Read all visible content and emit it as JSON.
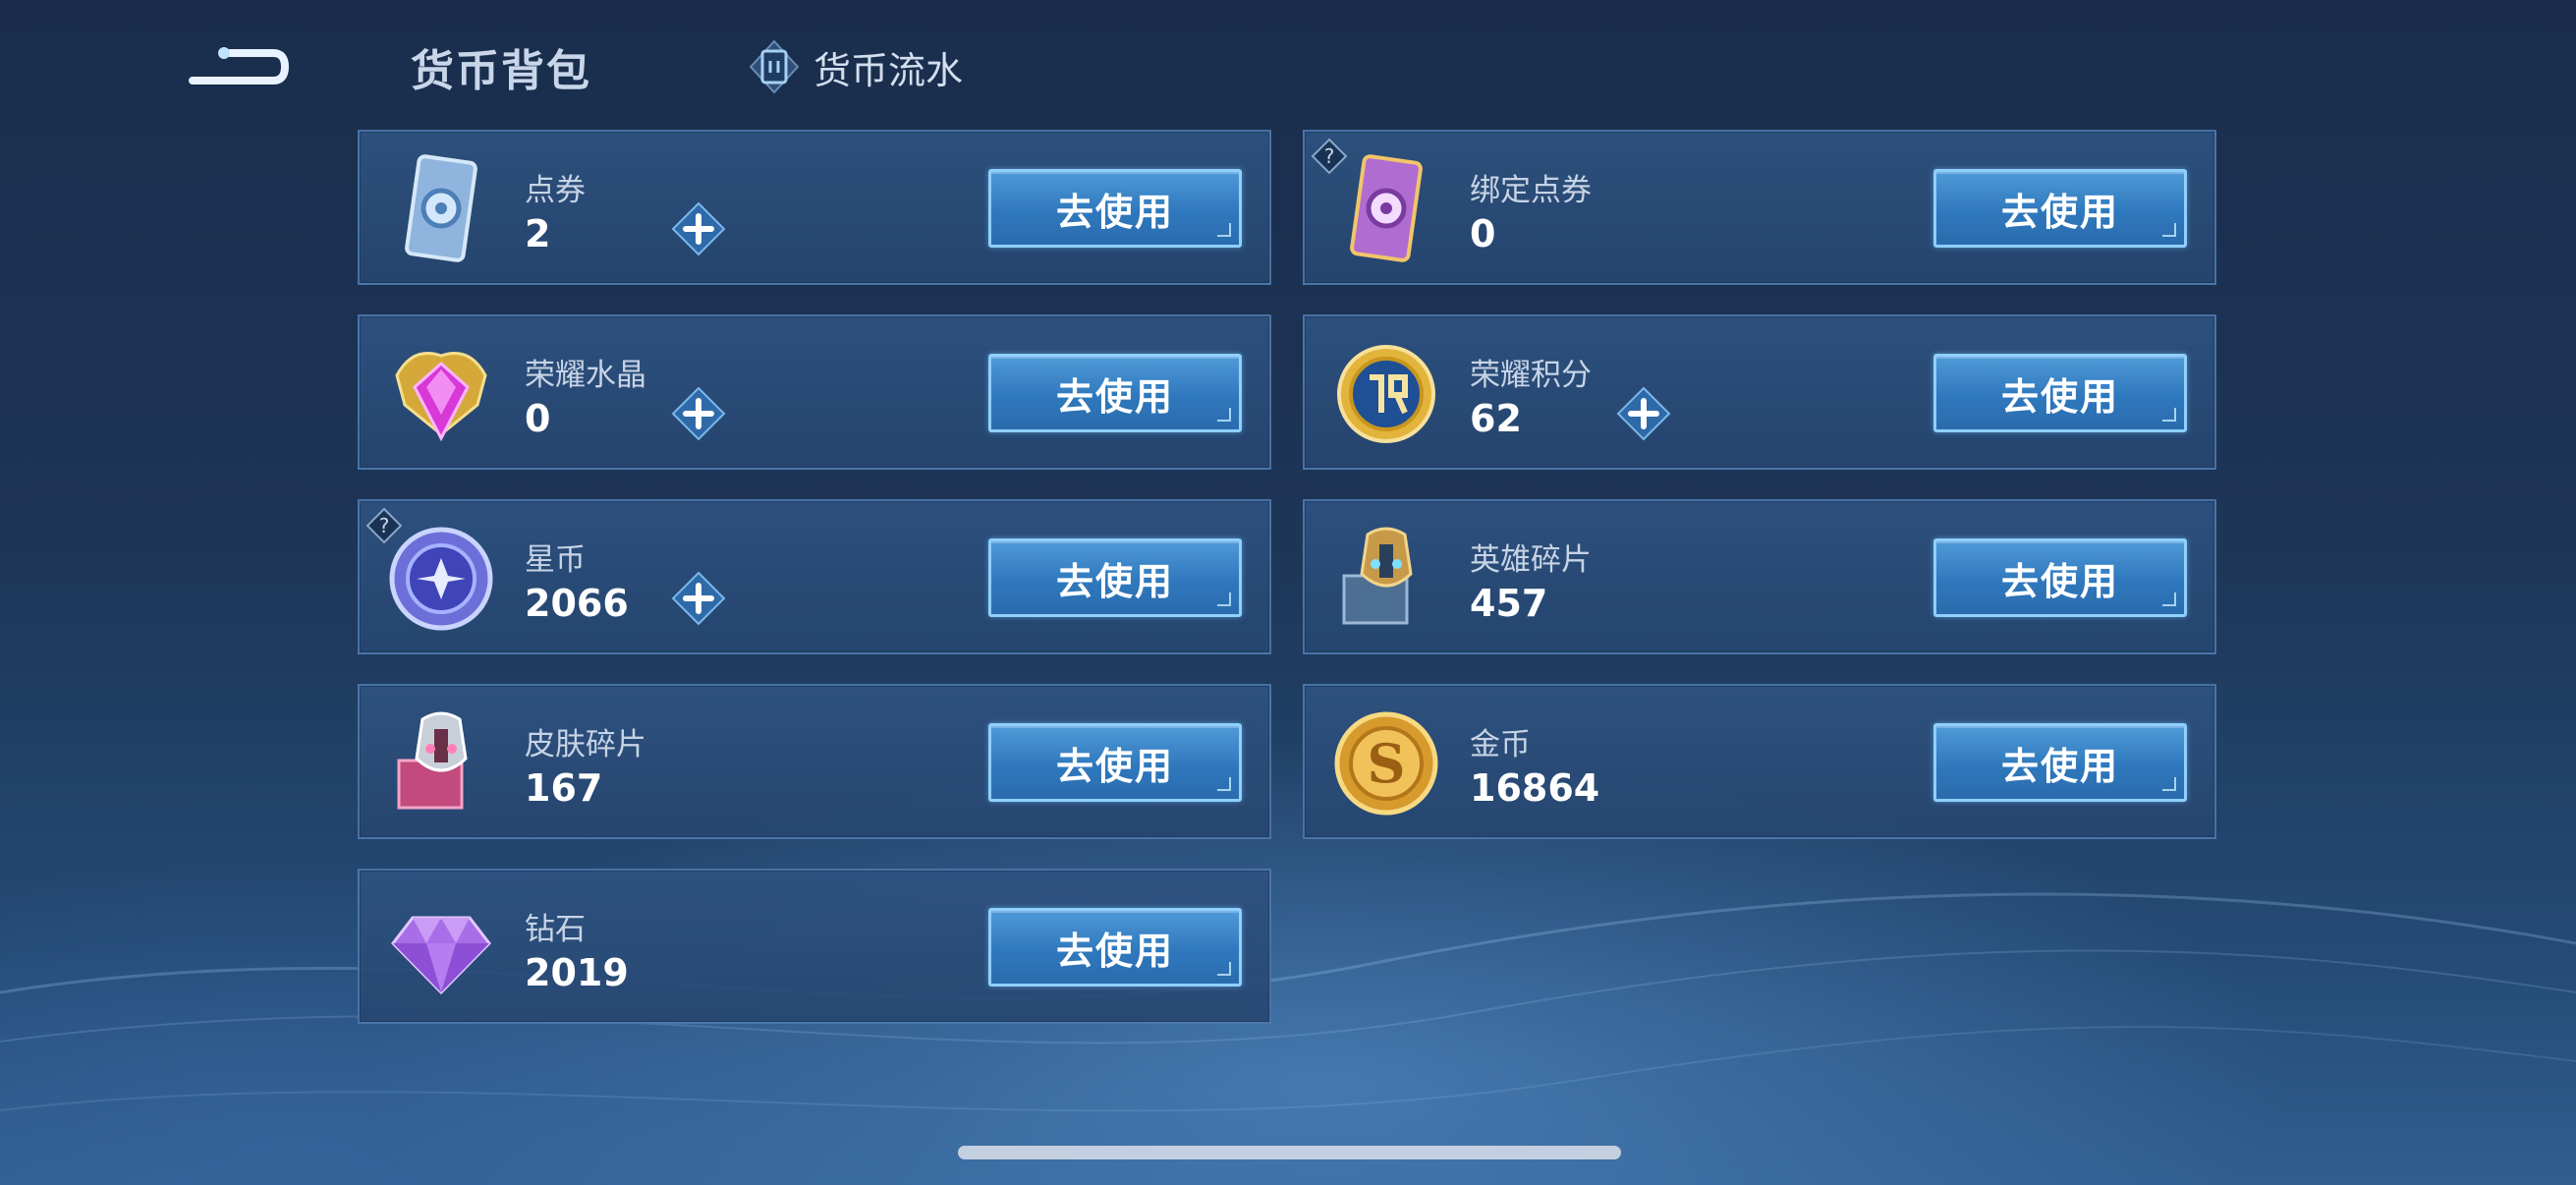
{
  "header": {
    "title": "货币背包",
    "flow_tab_label": "货币流水"
  },
  "currencies": [
    {
      "name": "点券",
      "value": "2",
      "button": "去使用",
      "has_plus": true,
      "has_help": false,
      "icon": "voucher-card-icon"
    },
    {
      "name": "绑定点券",
      "value": "0",
      "button": "去使用",
      "has_plus": false,
      "has_help": true,
      "icon": "bound-voucher-card-icon"
    },
    {
      "name": "荣耀水晶",
      "value": "0",
      "button": "去使用",
      "has_plus": true,
      "has_help": false,
      "icon": "glory-crystal-icon"
    },
    {
      "name": "荣耀积分",
      "value": "62",
      "button": "去使用",
      "has_plus": true,
      "has_help": false,
      "icon": "glory-points-icon"
    },
    {
      "name": "星币",
      "value": "2066",
      "button": "去使用",
      "has_plus": true,
      "has_help": true,
      "icon": "star-coin-icon"
    },
    {
      "name": "英雄碎片",
      "value": "457",
      "button": "去使用",
      "has_plus": false,
      "has_help": false,
      "icon": "hero-fragment-icon"
    },
    {
      "name": "皮肤碎片",
      "value": "167",
      "button": "去使用",
      "has_plus": false,
      "has_help": false,
      "icon": "skin-fragment-icon"
    },
    {
      "name": "金币",
      "value": "16864",
      "button": "去使用",
      "has_plus": false,
      "has_help": false,
      "icon": "gold-coin-icon"
    },
    {
      "name": "钻石",
      "value": "2019",
      "button": "去使用",
      "has_plus": false,
      "has_help": false,
      "icon": "diamond-icon"
    }
  ],
  "colors": {
    "background": "#1d3556",
    "card": "#2e5280",
    "button": "#3a86c8",
    "button_border": "#8fd0ff"
  }
}
